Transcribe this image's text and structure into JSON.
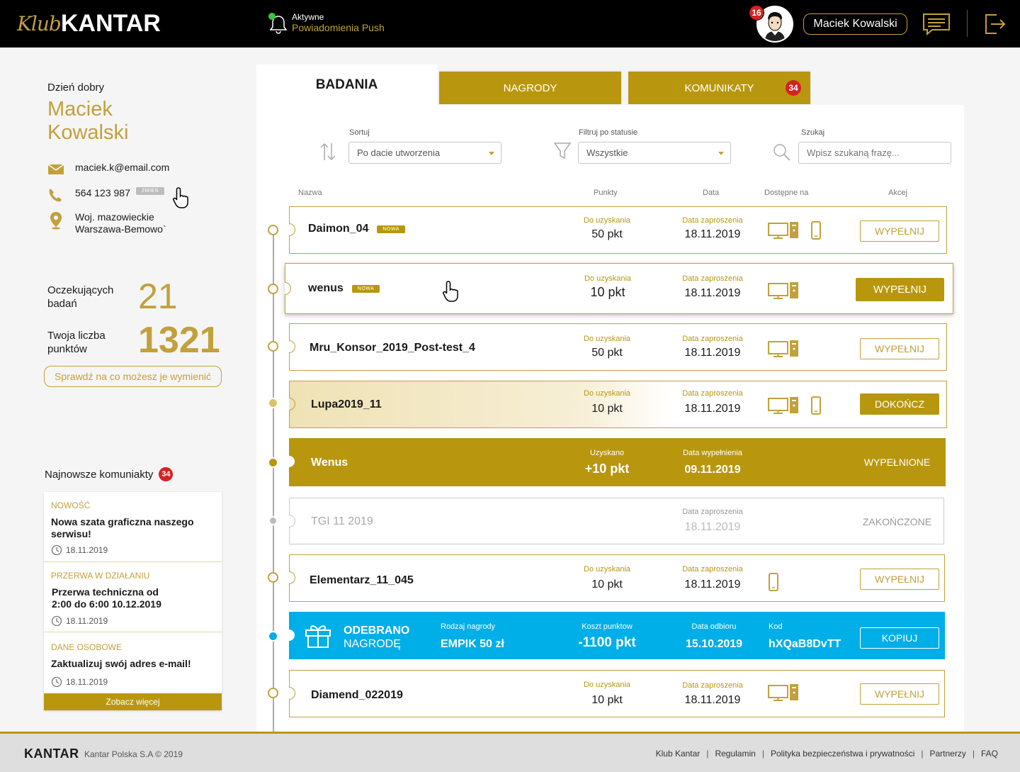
{
  "header": {
    "logo_klub": "Klub",
    "logo_kantar": "KANTAR",
    "push_status": "Aktywne",
    "push_label": "Powiadomienia Push",
    "avatar_badge": "16",
    "user_name": "Maciek Kowalski"
  },
  "profile": {
    "greeting": "Dzień dobry",
    "first_name": "Maciek",
    "last_name": "Kowalski",
    "email": "maciek.k@email.com",
    "phone": "564 123 987",
    "change_label": "ZMIEŃ",
    "region": "Woj. mazowieckie",
    "city": "Warszawa-Bemowo`"
  },
  "stats": {
    "pending_label_1": "Oczekujących",
    "pending_label_2": "badań",
    "pending_value": "21",
    "points_label_1": "Twoja liczba",
    "points_label_2": "punktów",
    "points_value": "1321",
    "check_button": "Sprawdź na co możesz je wymienić"
  },
  "news": {
    "title": "Najnowsze komuniakty",
    "count": "34",
    "items": [
      {
        "category": "NOWOŚĆ",
        "line1": "Nowa szata graficzna naszego",
        "line2": "serwisu!",
        "date": "18.11.2019"
      },
      {
        "category": "PRZERWA W DZIAŁANIU",
        "line1": "Przerwa techniczna od",
        "line2": "2:00 do 6:00 10.12.2019",
        "date": "18.11.2019"
      },
      {
        "category": "DANE OSOBOWE",
        "line1": "Zaktualizuj swój adres e-mail!",
        "line2": "",
        "date": "18.11.2019"
      }
    ],
    "more": "Zobacz więcej"
  },
  "tabs": {
    "badania": "BADANIA",
    "nagrody": "NAGRODY",
    "komunikaty": "KOMUNIKATY",
    "komunikaty_badge": "34"
  },
  "filters": {
    "sort_label": "Sortuj",
    "sort_value": "Po dacie utworzenia",
    "status_label": "Filtruj po statusie",
    "status_value": "Wszystkie",
    "search_label": "Szukaj",
    "search_placeholder": "Wpisz szukaną frazę..."
  },
  "columns": {
    "name": "Nazwa",
    "points": "Punkty",
    "date": "Data",
    "available": "Dostępne na",
    "actions": "Akcej"
  },
  "rows": [
    {
      "name": "Daimon_04",
      "badge": "NOWA",
      "pts_label": "Do uzyskania",
      "pts": "50 pkt",
      "date_label": "Data zaproszenia",
      "date": "18.11.2019",
      "action": "WYPEŁNIJ"
    },
    {
      "name": "wenus",
      "badge": "NOWA",
      "pts_label": "Do uzyskania",
      "pts": "10 pkt",
      "date_label": "Data zaproszenia",
      "date": "18.11.2019",
      "action": "WYPEŁNIJ"
    },
    {
      "name": "Mru_Konsor_2019_Post-test_4",
      "pts_label": "Do uzyskania",
      "pts": "50 pkt",
      "date_label": "Data zaproszenia",
      "date": "18.11.2019",
      "action": "WYPEŁNIJ"
    },
    {
      "name": "Lupa2019_11",
      "pts_label": "Do uzyskania",
      "pts": "10 pkt",
      "date_label": "Data zaproszenia",
      "date": "18.11.2019",
      "action": "DOKOŃCZ"
    },
    {
      "name": "Wenus",
      "pts_label": "Uzyskano",
      "pts": "+10 pkt",
      "date_label": "Data wypełnienia",
      "date": "09.11.2019",
      "action": "WYPEŁNIONE"
    },
    {
      "name": "TGI 11 2019",
      "date_label": "Data zaproszenia",
      "date": "18.11.2019",
      "action": "ZAKOŃCZONE"
    },
    {
      "name": "Elementarz_11_045",
      "pts_label": "Do uzyskania",
      "pts": "10 pkt",
      "date_label": "Data zaproszenia",
      "date": "18.11.2019",
      "action": "WYPEŁNIJ"
    },
    {
      "title_1": "ODEBRANO",
      "title_2": "NAGRODĘ",
      "reward_label": "Rodzaj nagrody",
      "reward": "EMPIK 50 zł",
      "cost_label": "Koszt punktow",
      "cost": "-1100 pkt",
      "date_label": "Data odbioru",
      "date": "15.10.2019",
      "code_label": "Kod",
      "code": "hXQaB8DvTT",
      "action": "KOPIUJ"
    },
    {
      "name": "Diamend_022019",
      "pts_label": "Do uzyskania",
      "pts": "10 pkt",
      "date_label": "Data zaproszenia",
      "date": "18.11.2019",
      "action": "WYPEŁNIJ"
    }
  ],
  "footer": {
    "logo": "KANTAR",
    "copyright": "Kantar Polska S.A © 2019",
    "links": [
      "Klub Kantar",
      "Regulamin",
      "Polityka bezpieczeństwa i prywatności",
      "Partnerzy",
      "FAQ"
    ]
  },
  "colors": {
    "gold": "#c2a03c",
    "gold_dark": "#b8970f",
    "blue": "#00aee8",
    "red": "#d62121"
  }
}
